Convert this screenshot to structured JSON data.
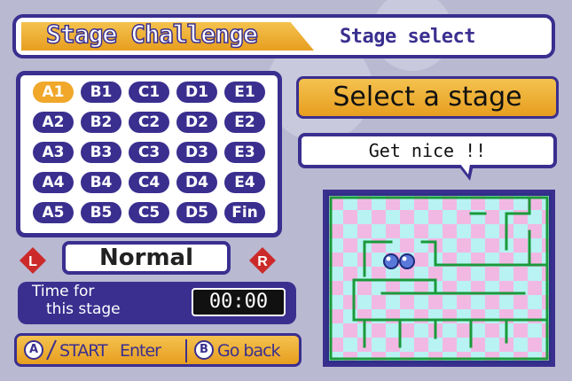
{
  "header": {
    "title": "Stage Challenge",
    "subtitle": "Stage select"
  },
  "stages": {
    "rows": [
      [
        "A1",
        "B1",
        "C1",
        "D1",
        "E1"
      ],
      [
        "A2",
        "B2",
        "C2",
        "D2",
        "E2"
      ],
      [
        "A3",
        "B3",
        "C3",
        "D3",
        "E3"
      ],
      [
        "A4",
        "B4",
        "C4",
        "D4",
        "E4"
      ],
      [
        "A5",
        "B5",
        "C5",
        "D5",
        "Fin"
      ]
    ],
    "selected": "A1"
  },
  "difficulty": {
    "left_button": "L",
    "label": "Normal",
    "right_button": "R"
  },
  "timer": {
    "label_line1": "Time for",
    "label_line2": "this stage",
    "value": "00:00"
  },
  "controls": {
    "a_button": "A",
    "start_label": "START",
    "enter_label": "Enter",
    "b_button": "B",
    "back_label": "Go back"
  },
  "prompt": {
    "banner": "Select a stage",
    "speech": "Get nice !!"
  },
  "colors": {
    "frame": "#3a2f8f",
    "accent": "#f0a72a",
    "tile_pink": "#f2b8e4",
    "tile_cyan": "#b8f2f2",
    "wall": "#1a9a3a"
  }
}
